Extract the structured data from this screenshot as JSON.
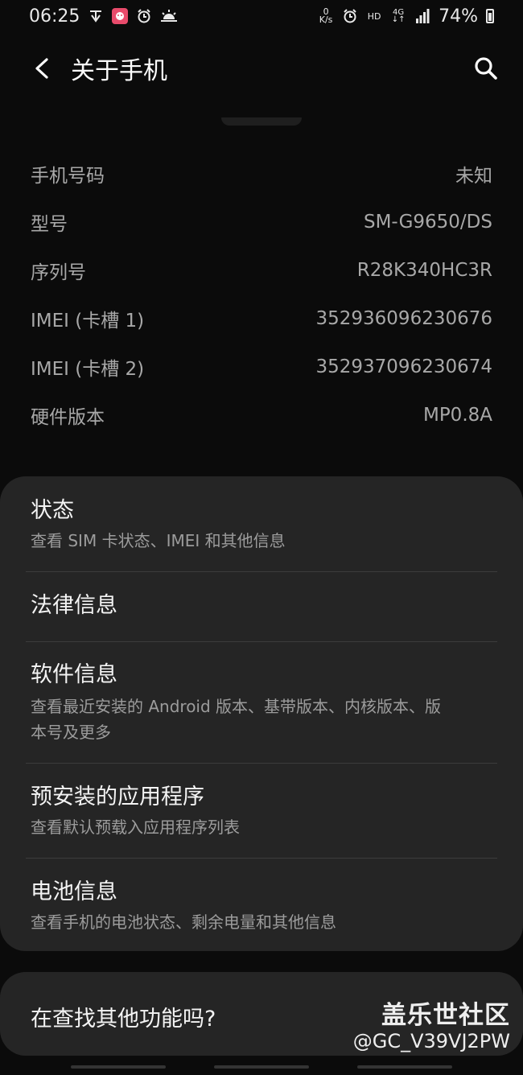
{
  "status_bar": {
    "time": "06:25",
    "left_icons": [
      "signal-text-icon",
      "app-notification-icon",
      "alarm-icon",
      "weather-icon"
    ],
    "right_icons": [
      "network-speed-icon",
      "alarm-icon",
      "hd-icon",
      "4g-icon",
      "signal-bars-icon"
    ],
    "speed_top": "0",
    "speed_bottom": "K/s",
    "hd_label": "HD",
    "lte_top": "4G",
    "lte_bottom": "↓↑",
    "battery": "74%"
  },
  "app_bar": {
    "title": "关于手机",
    "back_icon": "back-icon",
    "search_icon": "search-icon"
  },
  "info_rows": [
    {
      "label": "手机号码",
      "value": "未知"
    },
    {
      "label": "型号",
      "value": "SM-G9650/DS"
    },
    {
      "label": "序列号",
      "value": "R28K340HC3R"
    },
    {
      "label": "IMEI (卡槽 1)",
      "value": "352936096230676"
    },
    {
      "label": "IMEI (卡槽 2)",
      "value": "352937096230674"
    },
    {
      "label": "硬件版本",
      "value": "MP0.8A"
    }
  ],
  "menu": [
    {
      "title": "状态",
      "subtitle": "查看 SIM 卡状态、IMEI 和其他信息"
    },
    {
      "title": "法律信息",
      "subtitle": ""
    },
    {
      "title": "软件信息",
      "subtitle_line1": "查看最近安装的 Android 版本、基带版本、内核版本、版",
      "subtitle_line2": "本号及更多"
    },
    {
      "title": "预安装的应用程序",
      "subtitle": "查看默认预载入应用程序列表"
    },
    {
      "title": "电池信息",
      "subtitle": "查看手机的电池状态、剩余电量和其他信息"
    }
  ],
  "find_more": {
    "text": "在查找其他功能吗?"
  },
  "watermark": {
    "site": "盖乐世社区",
    "user": "@GC_V39VJ2PW"
  },
  "colors": {
    "background": "#0b0b0b",
    "card": "#252525",
    "primary_text": "#f4f4f4",
    "secondary_text": "#a8a8a8",
    "divider": "#3c3c3c"
  }
}
